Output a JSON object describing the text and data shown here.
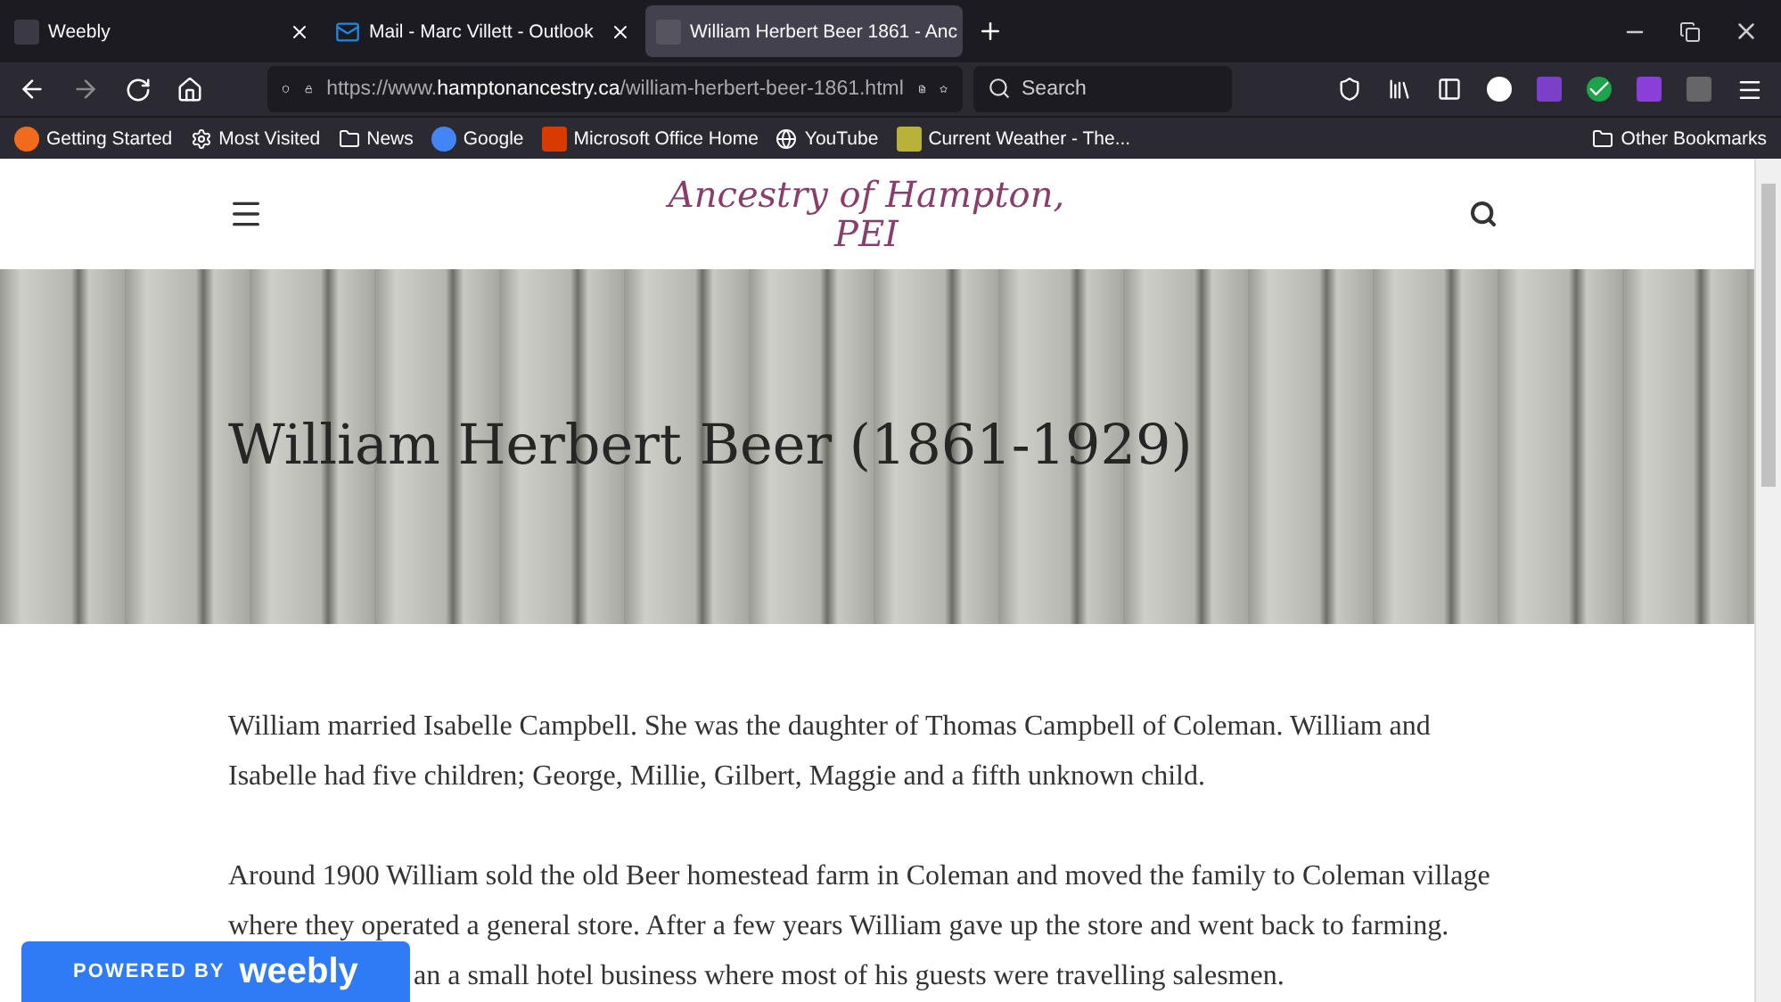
{
  "tabs": [
    {
      "title": "Weebly",
      "selected": false
    },
    {
      "title": "Mail - Marc Villett - Outlook",
      "selected": false
    },
    {
      "title": "William Herbert Beer 1861 - Anc",
      "selected": true
    }
  ],
  "address_bar": {
    "url_prefix": "https://www.",
    "url_domain": "hamptonancestry.ca",
    "url_path": "/william-herbert-beer-1861.html"
  },
  "search": {
    "placeholder": "Search"
  },
  "bookmarks": [
    {
      "label": "Getting Started"
    },
    {
      "label": "Most Visited"
    },
    {
      "label": "News"
    },
    {
      "label": "Google"
    },
    {
      "label": "Microsoft Office Home"
    },
    {
      "label": "YouTube"
    },
    {
      "label": "Current Weather - The..."
    }
  ],
  "other_bookmarks": "Other Bookmarks",
  "site": {
    "logo_line_1": "Ancestry of Hampton,",
    "logo_line_2": "PEI",
    "page_title": "William Herbert Beer (1861-1929)"
  },
  "paragraphs": [
    {
      "text": "William married Isabelle Campbell.  She was the daughter of Thomas Campbell of Coleman.  William and Isabelle had five children;  George, Millie, Gilbert, Maggie and a fifth unknown child."
    },
    {
      "text": "Around 1900 William sold the old Beer homestead farm in Coleman and moved the family to Coleman village where they operated a general store.  After a few years William gave up the store and went back to farming."
    }
  ],
  "partial_line": "an a small hotel business where most of his guests were travelling salesmen.",
  "badge": {
    "prefix": "POWERED BY",
    "brand": "weebly"
  }
}
